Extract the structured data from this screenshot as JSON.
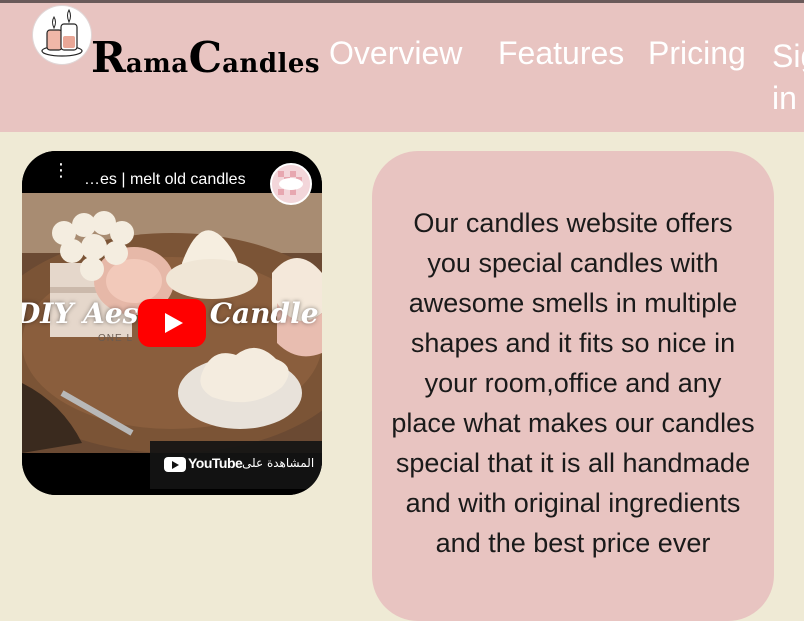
{
  "brand": {
    "r": "R",
    "ama": "ama",
    "c": "C",
    "andles": "andles"
  },
  "nav": {
    "items": [
      "Overview",
      "Features",
      "Pricing"
    ],
    "signin_line1": "Sig",
    "signin_line2": "in"
  },
  "video": {
    "title": "…es | melt old candles",
    "overlay_left": "DIY Aesth",
    "overlay_right": "Candle",
    "watch_on": "المشاهدة على",
    "youtube_word": "YouTube",
    "brand_text": "ONE L"
  },
  "card": {
    "text": "Our candles website offers you special candles with awesome smells in multiple shapes and it fits so nice in your room,office and any place what makes our candles special that it is all handmade and with original ingredients and the best price ever"
  },
  "colors": {
    "background": "#efead5",
    "header": "#e8c4c1",
    "card": "#e8c4c1",
    "youtube_red": "#ff0000"
  }
}
